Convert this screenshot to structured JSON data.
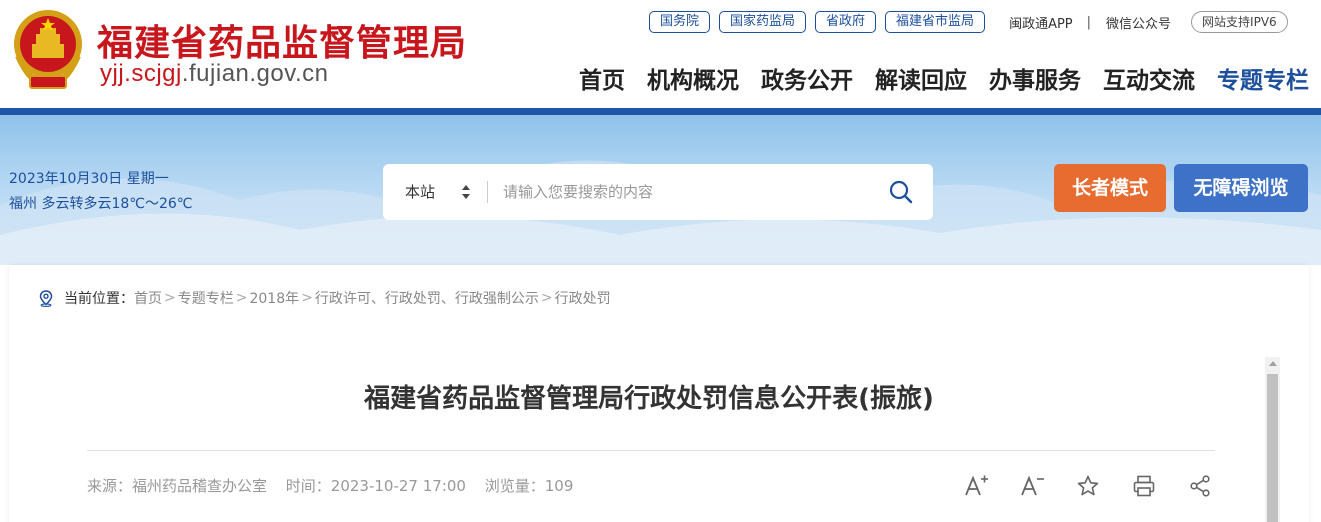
{
  "header": {
    "site_title": "福建省药品监督管理局",
    "domain_prefix": "yjj.scjgj",
    "domain_suffix": ".fujian.gov.cn",
    "top_links": [
      "国务院",
      "国家药监局",
      "省政府",
      "福建省市监局"
    ],
    "app_link": "闽政通APP",
    "separator": "|",
    "wechat_link": "微信公众号",
    "ipv6_label": "网站支持IPV6",
    "nav": [
      "首页",
      "机构概况",
      "政务公开",
      "解读回应",
      "办事服务",
      "互动交流",
      "专题专栏"
    ],
    "active_nav": "专题专栏"
  },
  "banner": {
    "date_line": "2023年10月30日 星期一",
    "weather_line": "福州 多云转多云18℃～26℃",
    "search_scope": "本站",
    "search_placeholder": "请输入您要搜索的内容",
    "elder_mode_label": "长者模式",
    "accessible_label": "无障碍浏览"
  },
  "breadcrumb": {
    "label": "当前位置：",
    "items": [
      "首页",
      "专题专栏",
      "2018年",
      "行政许可、行政处罚、行政强制公示",
      "行政处罚"
    ],
    "separator": ">"
  },
  "article": {
    "title": "福建省药品监督管理局行政处罚信息公开表(振旅)",
    "source": "来源：福州药品稽查办公室",
    "time": "时间：2023-10-27 17:00",
    "views": "浏览量：109"
  },
  "colors": {
    "brand_red": "#c8161d",
    "brand_blue": "#1c4f9c",
    "elder_orange": "#e86b2f",
    "access_blue": "#3d72c8"
  },
  "icons": [
    "national-emblem-icon",
    "chevron-updown-icon",
    "search-icon",
    "location-pin-icon",
    "font-increase-icon",
    "font-decrease-icon",
    "star-icon",
    "print-icon",
    "share-icon"
  ]
}
